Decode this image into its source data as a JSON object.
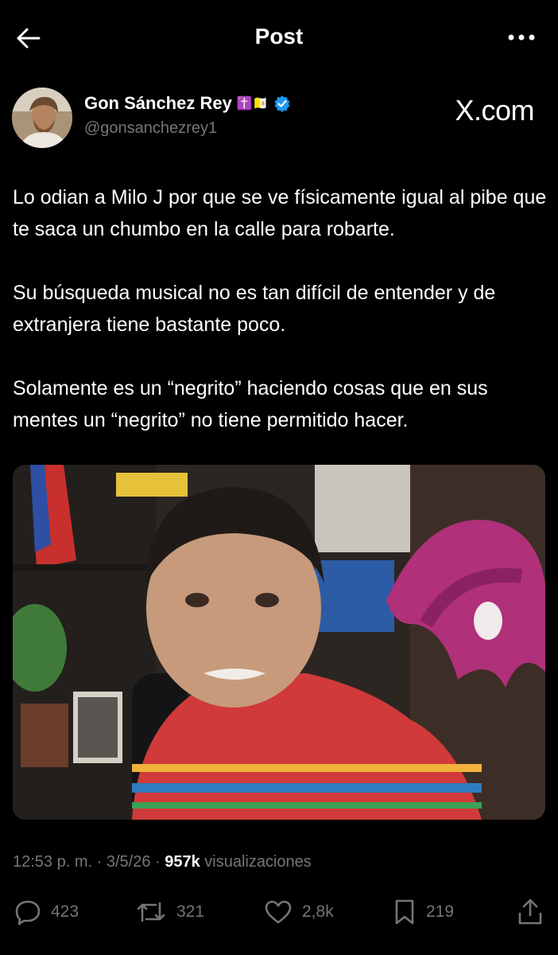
{
  "header": {
    "title": "Post",
    "back_icon": "arrow-left-icon",
    "more_icon": "more-dots-icon"
  },
  "author": {
    "name": "Gon Sánchez Rey",
    "name_emojis": "✝️🇻🇦",
    "handle": "@gonsanchezrey1",
    "verified_color": "#1d9bf0"
  },
  "watermark": "X.com",
  "post": {
    "paragraphs": [
      "Lo odian a Milo J por que se ve físicamente igual al pibe que te saca un chumbo en la calle para robarte.",
      "Su búsqueda musical no es tan difícil de entender y de extranjera tiene bastante poco.",
      "Solamente es un “negrito” haciendo cosas que en sus mentes un “negrito” no tiene permitido hacer."
    ]
  },
  "meta": {
    "time": "12:53 p. m.",
    "sep1": " · ",
    "date": "3/5/26",
    "sep2": " · ",
    "views_count": "957k",
    "views_label": " visualizaciones"
  },
  "actions": {
    "replies": "423",
    "reposts": "321",
    "likes": "2,8k",
    "bookmarks": "219"
  }
}
